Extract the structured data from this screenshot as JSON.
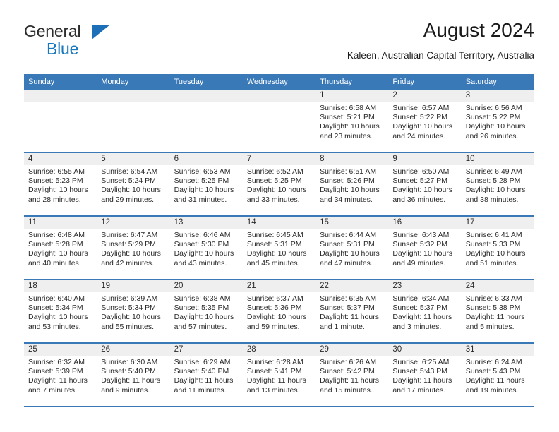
{
  "brand": {
    "line1": "General",
    "line2": "Blue",
    "triangle_color": "#1d6fb8",
    "text_color": "#2d2d2d",
    "accent_color": "#1877bd"
  },
  "header": {
    "title": "August 2024",
    "subtitle": "Kaleen, Australian Capital Territory, Australia"
  },
  "theme": {
    "header_blue": "#3a79b8",
    "daynum_band": "#efefef",
    "text": "#2a2a2a"
  },
  "weekdays": [
    "Sunday",
    "Monday",
    "Tuesday",
    "Wednesday",
    "Thursday",
    "Friday",
    "Saturday"
  ],
  "weeks": [
    [
      {
        "day": "",
        "empty": true
      },
      {
        "day": "",
        "empty": true
      },
      {
        "day": "",
        "empty": true
      },
      {
        "day": "",
        "empty": true
      },
      {
        "day": "1",
        "sunrise": "Sunrise: 6:58 AM",
        "sunset": "Sunset: 5:21 PM",
        "daylight1": "Daylight: 10 hours",
        "daylight2": "and 23 minutes."
      },
      {
        "day": "2",
        "sunrise": "Sunrise: 6:57 AM",
        "sunset": "Sunset: 5:22 PM",
        "daylight1": "Daylight: 10 hours",
        "daylight2": "and 24 minutes."
      },
      {
        "day": "3",
        "sunrise": "Sunrise: 6:56 AM",
        "sunset": "Sunset: 5:22 PM",
        "daylight1": "Daylight: 10 hours",
        "daylight2": "and 26 minutes."
      }
    ],
    [
      {
        "day": "4",
        "sunrise": "Sunrise: 6:55 AM",
        "sunset": "Sunset: 5:23 PM",
        "daylight1": "Daylight: 10 hours",
        "daylight2": "and 28 minutes."
      },
      {
        "day": "5",
        "sunrise": "Sunrise: 6:54 AM",
        "sunset": "Sunset: 5:24 PM",
        "daylight1": "Daylight: 10 hours",
        "daylight2": "and 29 minutes."
      },
      {
        "day": "6",
        "sunrise": "Sunrise: 6:53 AM",
        "sunset": "Sunset: 5:25 PM",
        "daylight1": "Daylight: 10 hours",
        "daylight2": "and 31 minutes."
      },
      {
        "day": "7",
        "sunrise": "Sunrise: 6:52 AM",
        "sunset": "Sunset: 5:25 PM",
        "daylight1": "Daylight: 10 hours",
        "daylight2": "and 33 minutes."
      },
      {
        "day": "8",
        "sunrise": "Sunrise: 6:51 AM",
        "sunset": "Sunset: 5:26 PM",
        "daylight1": "Daylight: 10 hours",
        "daylight2": "and 34 minutes."
      },
      {
        "day": "9",
        "sunrise": "Sunrise: 6:50 AM",
        "sunset": "Sunset: 5:27 PM",
        "daylight1": "Daylight: 10 hours",
        "daylight2": "and 36 minutes."
      },
      {
        "day": "10",
        "sunrise": "Sunrise: 6:49 AM",
        "sunset": "Sunset: 5:28 PM",
        "daylight1": "Daylight: 10 hours",
        "daylight2": "and 38 minutes."
      }
    ],
    [
      {
        "day": "11",
        "sunrise": "Sunrise: 6:48 AM",
        "sunset": "Sunset: 5:28 PM",
        "daylight1": "Daylight: 10 hours",
        "daylight2": "and 40 minutes."
      },
      {
        "day": "12",
        "sunrise": "Sunrise: 6:47 AM",
        "sunset": "Sunset: 5:29 PM",
        "daylight1": "Daylight: 10 hours",
        "daylight2": "and 42 minutes."
      },
      {
        "day": "13",
        "sunrise": "Sunrise: 6:46 AM",
        "sunset": "Sunset: 5:30 PM",
        "daylight1": "Daylight: 10 hours",
        "daylight2": "and 43 minutes."
      },
      {
        "day": "14",
        "sunrise": "Sunrise: 6:45 AM",
        "sunset": "Sunset: 5:31 PM",
        "daylight1": "Daylight: 10 hours",
        "daylight2": "and 45 minutes."
      },
      {
        "day": "15",
        "sunrise": "Sunrise: 6:44 AM",
        "sunset": "Sunset: 5:31 PM",
        "daylight1": "Daylight: 10 hours",
        "daylight2": "and 47 minutes."
      },
      {
        "day": "16",
        "sunrise": "Sunrise: 6:43 AM",
        "sunset": "Sunset: 5:32 PM",
        "daylight1": "Daylight: 10 hours",
        "daylight2": "and 49 minutes."
      },
      {
        "day": "17",
        "sunrise": "Sunrise: 6:41 AM",
        "sunset": "Sunset: 5:33 PM",
        "daylight1": "Daylight: 10 hours",
        "daylight2": "and 51 minutes."
      }
    ],
    [
      {
        "day": "18",
        "sunrise": "Sunrise: 6:40 AM",
        "sunset": "Sunset: 5:34 PM",
        "daylight1": "Daylight: 10 hours",
        "daylight2": "and 53 minutes."
      },
      {
        "day": "19",
        "sunrise": "Sunrise: 6:39 AM",
        "sunset": "Sunset: 5:34 PM",
        "daylight1": "Daylight: 10 hours",
        "daylight2": "and 55 minutes."
      },
      {
        "day": "20",
        "sunrise": "Sunrise: 6:38 AM",
        "sunset": "Sunset: 5:35 PM",
        "daylight1": "Daylight: 10 hours",
        "daylight2": "and 57 minutes."
      },
      {
        "day": "21",
        "sunrise": "Sunrise: 6:37 AM",
        "sunset": "Sunset: 5:36 PM",
        "daylight1": "Daylight: 10 hours",
        "daylight2": "and 59 minutes."
      },
      {
        "day": "22",
        "sunrise": "Sunrise: 6:35 AM",
        "sunset": "Sunset: 5:37 PM",
        "daylight1": "Daylight: 11 hours",
        "daylight2": "and 1 minute."
      },
      {
        "day": "23",
        "sunrise": "Sunrise: 6:34 AM",
        "sunset": "Sunset: 5:37 PM",
        "daylight1": "Daylight: 11 hours",
        "daylight2": "and 3 minutes."
      },
      {
        "day": "24",
        "sunrise": "Sunrise: 6:33 AM",
        "sunset": "Sunset: 5:38 PM",
        "daylight1": "Daylight: 11 hours",
        "daylight2": "and 5 minutes."
      }
    ],
    [
      {
        "day": "25",
        "sunrise": "Sunrise: 6:32 AM",
        "sunset": "Sunset: 5:39 PM",
        "daylight1": "Daylight: 11 hours",
        "daylight2": "and 7 minutes."
      },
      {
        "day": "26",
        "sunrise": "Sunrise: 6:30 AM",
        "sunset": "Sunset: 5:40 PM",
        "daylight1": "Daylight: 11 hours",
        "daylight2": "and 9 minutes."
      },
      {
        "day": "27",
        "sunrise": "Sunrise: 6:29 AM",
        "sunset": "Sunset: 5:40 PM",
        "daylight1": "Daylight: 11 hours",
        "daylight2": "and 11 minutes."
      },
      {
        "day": "28",
        "sunrise": "Sunrise: 6:28 AM",
        "sunset": "Sunset: 5:41 PM",
        "daylight1": "Daylight: 11 hours",
        "daylight2": "and 13 minutes."
      },
      {
        "day": "29",
        "sunrise": "Sunrise: 6:26 AM",
        "sunset": "Sunset: 5:42 PM",
        "daylight1": "Daylight: 11 hours",
        "daylight2": "and 15 minutes."
      },
      {
        "day": "30",
        "sunrise": "Sunrise: 6:25 AM",
        "sunset": "Sunset: 5:43 PM",
        "daylight1": "Daylight: 11 hours",
        "daylight2": "and 17 minutes."
      },
      {
        "day": "31",
        "sunrise": "Sunrise: 6:24 AM",
        "sunset": "Sunset: 5:43 PM",
        "daylight1": "Daylight: 11 hours",
        "daylight2": "and 19 minutes."
      }
    ]
  ]
}
